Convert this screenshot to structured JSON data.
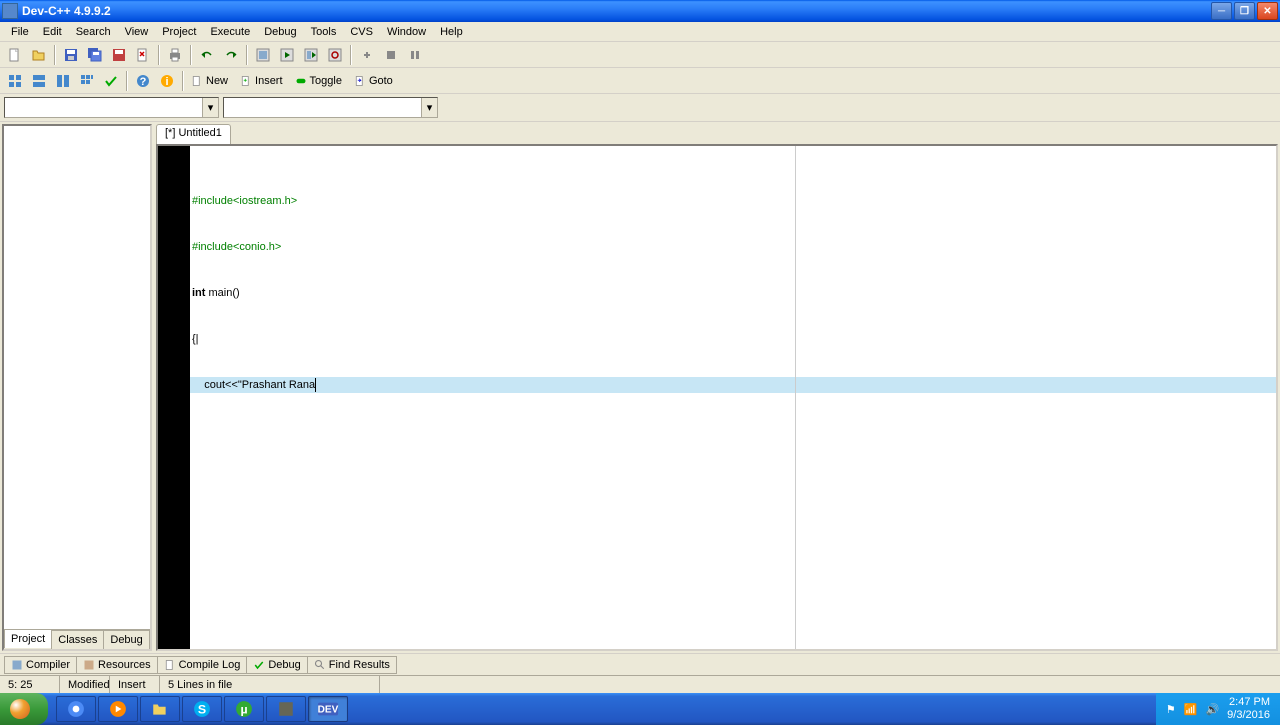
{
  "title": "Dev-C++ 4.9.9.2",
  "menu": [
    "File",
    "Edit",
    "Search",
    "View",
    "Project",
    "Execute",
    "Debug",
    "Tools",
    "CVS",
    "Window",
    "Help"
  ],
  "toolbar2": {
    "new": "New",
    "insert": "Insert",
    "toggle": "Toggle",
    "goto": "Goto"
  },
  "left_tabs": [
    "Project",
    "Classes",
    "Debug"
  ],
  "editor_tab": "[*] Untitled1",
  "code": {
    "line1": "#include<iostream.h>",
    "line2": "#include<conio.h>",
    "line3a": "int",
    "line3b": " main()",
    "line4": "{|",
    "line5a": "    cout<<",
    "line5b": "\"Prashant Rana"
  },
  "bottom_tabs": [
    "Compiler",
    "Resources",
    "Compile Log",
    "Debug",
    "Find Results"
  ],
  "status": {
    "pos": "5: 25",
    "modified": "Modified",
    "mode": "Insert",
    "info": "5 Lines in file"
  },
  "systray": {
    "time": "2:47 PM",
    "date": "9/3/2016"
  }
}
